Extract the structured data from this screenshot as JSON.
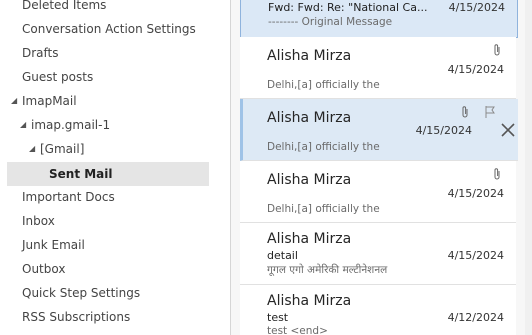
{
  "folders": [
    {
      "label": "Deleted Items"
    },
    {
      "label": "Conversation Action Settings"
    },
    {
      "label": "Drafts"
    },
    {
      "label": "Guest posts"
    },
    {
      "label": "ImapMail"
    },
    {
      "label": "imap.gmail-1"
    },
    {
      "label": "[Gmail]"
    },
    {
      "label": "Sent Mail"
    },
    {
      "label": "Important Docs"
    },
    {
      "label": "Inbox"
    },
    {
      "label": "Junk Email"
    },
    {
      "label": "Outbox"
    },
    {
      "label": "Quick Step Settings"
    },
    {
      "label": "RSS Subscriptions"
    }
  ],
  "messages": [
    {
      "subject": "Fwd: Fwd: Re: \"National Ca...",
      "preview": "-------- Original Message",
      "date": "4/15/2024"
    },
    {
      "sender": "Alisha Mirza",
      "preview": "Delhi,[a] officially the",
      "date": "4/15/2024"
    },
    {
      "sender": "Alisha Mirza",
      "preview": "Delhi,[a] officially the",
      "date": "4/15/2024"
    },
    {
      "sender": "Alisha Mirza",
      "preview": "Delhi,[a] officially the",
      "date": "4/15/2024"
    },
    {
      "sender": "Alisha Mirza",
      "subject": "detail",
      "preview": "गूगल एगो अमेरिकी मल्टीनेशनल",
      "date": "4/15/2024"
    },
    {
      "sender": "Alisha Mirza",
      "subject": "test",
      "preview": "test <end>",
      "date": "4/12/2024"
    }
  ],
  "colors": {
    "selected_folder_bg": "#e5e5e5",
    "hover_row_bg": "#dde9f5",
    "accent": "#9fc3e7"
  }
}
